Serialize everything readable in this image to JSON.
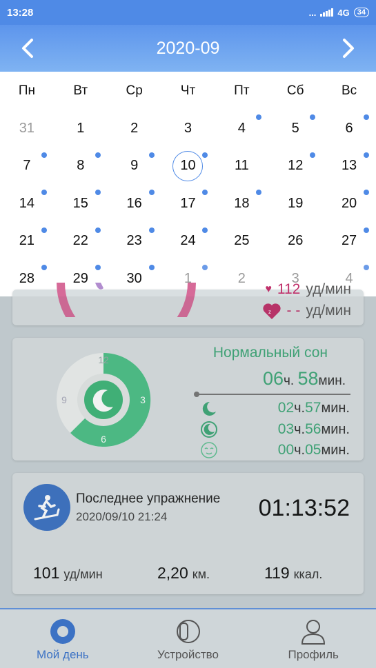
{
  "status_bar": {
    "time": "13:28",
    "dots": "...",
    "network": "4G",
    "battery": "34"
  },
  "header": {
    "title": "2020-09"
  },
  "calendar": {
    "weekdays": [
      "Пн",
      "Вт",
      "Ср",
      "Чт",
      "Пт",
      "Сб",
      "Вс"
    ],
    "days": [
      {
        "d": "31",
        "other": true,
        "dot": false
      },
      {
        "d": "1",
        "other": false,
        "dot": false
      },
      {
        "d": "2",
        "other": false,
        "dot": false
      },
      {
        "d": "3",
        "other": false,
        "dot": false
      },
      {
        "d": "4",
        "other": false,
        "dot": true
      },
      {
        "d": "5",
        "other": false,
        "dot": true
      },
      {
        "d": "6",
        "other": false,
        "dot": true
      },
      {
        "d": "7",
        "other": false,
        "dot": true
      },
      {
        "d": "8",
        "other": false,
        "dot": true
      },
      {
        "d": "9",
        "other": false,
        "dot": true
      },
      {
        "d": "10",
        "other": false,
        "dot": true,
        "today": true
      },
      {
        "d": "11",
        "other": false,
        "dot": false
      },
      {
        "d": "12",
        "other": false,
        "dot": true
      },
      {
        "d": "13",
        "other": false,
        "dot": true
      },
      {
        "d": "14",
        "other": false,
        "dot": true
      },
      {
        "d": "15",
        "other": false,
        "dot": true
      },
      {
        "d": "16",
        "other": false,
        "dot": true
      },
      {
        "d": "17",
        "other": false,
        "dot": true
      },
      {
        "d": "18",
        "other": false,
        "dot": true
      },
      {
        "d": "19",
        "other": false,
        "dot": false
      },
      {
        "d": "20",
        "other": false,
        "dot": true
      },
      {
        "d": "21",
        "other": false,
        "dot": true
      },
      {
        "d": "22",
        "other": false,
        "dot": true
      },
      {
        "d": "23",
        "other": false,
        "dot": true
      },
      {
        "d": "24",
        "other": false,
        "dot": true
      },
      {
        "d": "25",
        "other": false,
        "dot": false
      },
      {
        "d": "26",
        "other": false,
        "dot": false
      },
      {
        "d": "27",
        "other": false,
        "dot": true
      },
      {
        "d": "28",
        "other": false,
        "dot": true
      },
      {
        "d": "29",
        "other": false,
        "dot": true
      },
      {
        "d": "30",
        "other": false,
        "dot": true
      },
      {
        "d": "1",
        "other": true,
        "dot": true
      },
      {
        "d": "2",
        "other": true,
        "dot": false
      },
      {
        "d": "3",
        "other": true,
        "dot": false
      },
      {
        "d": "4",
        "other": true,
        "dot": true
      }
    ]
  },
  "heart": {
    "max_value": "112",
    "unit": "уд/мин",
    "sleep_value": "- -",
    "sleep_unit": "уд/мин"
  },
  "sleep": {
    "title": "Нормальный сон",
    "total_h": "06",
    "h": "ч.",
    "total_m": "58",
    "m": "мин.",
    "clock_labels": [
      "12",
      "3",
      "6",
      "9"
    ],
    "rows": [
      {
        "h": "02",
        "m": "57"
      },
      {
        "h": "03",
        "m": "56"
      },
      {
        "h": "00",
        "m": "05"
      }
    ]
  },
  "exercise": {
    "title": "Последнее упражнение",
    "date": "2020/09/10 21:24",
    "duration": "01:13:52",
    "hr": "101",
    "hr_unit": "уд/мин",
    "distance": "2,20",
    "distance_unit": "км.",
    "calories": "119",
    "calories_unit": "ккал."
  },
  "nav": {
    "day": "Мой день",
    "device": "Устройство",
    "profile": "Профиль"
  },
  "colors": {
    "accent": "#4f8ae6",
    "sleep_green": "#3ea878",
    "heart": "#c0306a"
  }
}
